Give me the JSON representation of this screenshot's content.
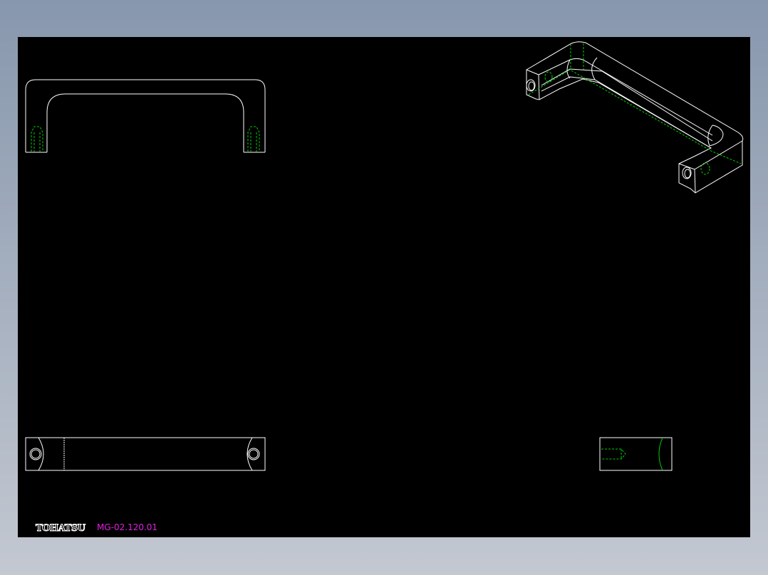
{
  "drawing": {
    "brand_logo": "TOHATSU",
    "part_number": "MG-02.120.01",
    "views": [
      "front-view",
      "bottom-view",
      "side-view",
      "isometric-view"
    ],
    "colors": {
      "background": "#000000",
      "outline": "#ffffff",
      "hidden": "#00c000",
      "part_number": "#e020e0"
    }
  }
}
